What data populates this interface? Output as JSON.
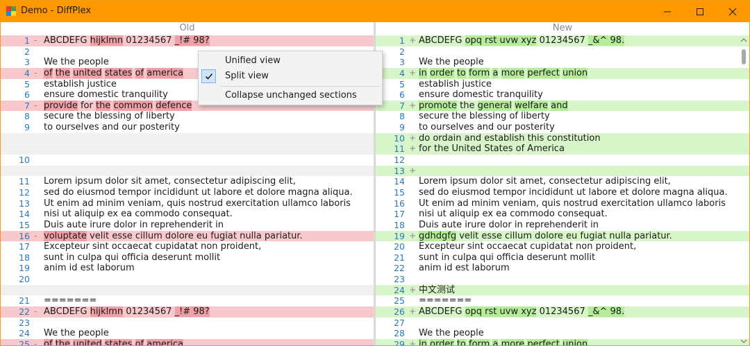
{
  "window": {
    "title": "Demo - DiffPlex"
  },
  "left_pane": {
    "header": "Old",
    "lines": [
      {
        "n": "1",
        "m": "-",
        "t": "del",
        "seg": [
          [
            "ABCDEFG ",
            0
          ],
          [
            "hijklmn",
            1
          ],
          [
            " 01234567 ",
            0
          ],
          [
            "_!# 98?",
            1
          ]
        ]
      },
      {
        "n": "2",
        "m": "",
        "t": "",
        "seg": [
          [
            "",
            0
          ]
        ]
      },
      {
        "n": "3",
        "m": "",
        "t": "",
        "seg": [
          [
            "We the people",
            0
          ]
        ]
      },
      {
        "n": "4",
        "m": "-",
        "t": "del",
        "seg": [
          [
            "of",
            1
          ],
          [
            " ",
            0
          ],
          [
            "the",
            1
          ],
          [
            " ",
            0
          ],
          [
            "united",
            1
          ],
          [
            " ",
            0
          ],
          [
            "states",
            1
          ],
          [
            " ",
            0
          ],
          [
            "of",
            1
          ],
          [
            " ",
            0
          ],
          [
            "america",
            1
          ]
        ]
      },
      {
        "n": "5",
        "m": "",
        "t": "",
        "seg": [
          [
            "establish justice",
            0
          ]
        ]
      },
      {
        "n": "6",
        "m": "",
        "t": "",
        "seg": [
          [
            "ensure domestic tranquility",
            0
          ]
        ]
      },
      {
        "n": "7",
        "m": "-",
        "t": "del",
        "seg": [
          [
            "provide",
            1
          ],
          [
            " for ",
            0
          ],
          [
            "the",
            1
          ],
          [
            " ",
            0
          ],
          [
            "common",
            1
          ],
          [
            " ",
            0
          ],
          [
            "defence",
            1
          ]
        ]
      },
      {
        "n": "8",
        "m": "",
        "t": "",
        "seg": [
          [
            "secure the blessing of liberty",
            0
          ]
        ]
      },
      {
        "n": "9",
        "m": "",
        "t": "",
        "seg": [
          [
            "to ourselves and our posterity",
            0
          ]
        ]
      },
      {
        "n": "",
        "m": "",
        "t": "imag",
        "seg": [
          [
            "",
            0
          ]
        ]
      },
      {
        "n": "",
        "m": "",
        "t": "imag",
        "seg": [
          [
            "",
            0
          ]
        ]
      },
      {
        "n": "10",
        "m": "",
        "t": "",
        "seg": [
          [
            "",
            0
          ]
        ]
      },
      {
        "n": "",
        "m": "",
        "t": "imag",
        "seg": [
          [
            "",
            0
          ]
        ]
      },
      {
        "n": "11",
        "m": "",
        "t": "",
        "seg": [
          [
            "Lorem ipsum dolor sit amet, consectetur adipiscing elit,",
            0
          ]
        ]
      },
      {
        "n": "12",
        "m": "",
        "t": "",
        "seg": [
          [
            "sed do eiusmod tempor incididunt ut labore et dolore magna aliqua.",
            0
          ]
        ]
      },
      {
        "n": "13",
        "m": "",
        "t": "",
        "seg": [
          [
            "Ut enim ad minim veniam, quis nostrud exercitation ullamco laboris",
            0
          ]
        ]
      },
      {
        "n": "14",
        "m": "",
        "t": "",
        "seg": [
          [
            "nisi ut aliquip ex ea commodo consequat.",
            0
          ]
        ]
      },
      {
        "n": "15",
        "m": "",
        "t": "",
        "seg": [
          [
            "Duis aute irure dolor in reprehenderit in",
            0
          ]
        ]
      },
      {
        "n": "16",
        "m": "-",
        "t": "del",
        "seg": [
          [
            "voluptate",
            1
          ],
          [
            " velit esse cillum dolore eu fugiat nulla pariatur.",
            0
          ]
        ]
      },
      {
        "n": "17",
        "m": "",
        "t": "",
        "seg": [
          [
            "Excepteur sint occaecat cupidatat non proident,",
            0
          ]
        ]
      },
      {
        "n": "18",
        "m": "",
        "t": "",
        "seg": [
          [
            "sunt in culpa qui officia deserunt mollit",
            0
          ]
        ]
      },
      {
        "n": "19",
        "m": "",
        "t": "",
        "seg": [
          [
            "anim id est laborum",
            0
          ]
        ]
      },
      {
        "n": "20",
        "m": "",
        "t": "",
        "seg": [
          [
            "",
            0
          ]
        ]
      },
      {
        "n": "",
        "m": "",
        "t": "imag",
        "seg": [
          [
            "",
            0
          ]
        ]
      },
      {
        "n": "21",
        "m": "",
        "t": "",
        "seg": [
          [
            "=======",
            0
          ]
        ]
      },
      {
        "n": "22",
        "m": "-",
        "t": "del",
        "seg": [
          [
            "ABCDEFG ",
            0
          ],
          [
            "hijklmn",
            1
          ],
          [
            " 01234567 ",
            0
          ],
          [
            "_!# 98?",
            1
          ]
        ]
      },
      {
        "n": "23",
        "m": "",
        "t": "",
        "seg": [
          [
            "",
            0
          ]
        ]
      },
      {
        "n": "24",
        "m": "",
        "t": "",
        "seg": [
          [
            "We the people",
            0
          ]
        ]
      },
      {
        "n": "25",
        "m": "-",
        "t": "del",
        "seg": [
          [
            "of",
            1
          ],
          [
            " ",
            0
          ],
          [
            "the",
            1
          ],
          [
            " ",
            0
          ],
          [
            "united",
            1
          ],
          [
            " ",
            0
          ],
          [
            "states",
            1
          ],
          [
            " ",
            0
          ],
          [
            "of",
            1
          ],
          [
            " ",
            0
          ],
          [
            "america",
            1
          ]
        ]
      }
    ]
  },
  "right_pane": {
    "header": "New",
    "lines": [
      {
        "n": "1",
        "m": "+",
        "t": "ins",
        "seg": [
          [
            "ABCDEFG ",
            0
          ],
          [
            "opq rst uvw xyz",
            1
          ],
          [
            " 01234567 ",
            0
          ],
          [
            "_&^ 98.",
            1
          ]
        ]
      },
      {
        "n": "2",
        "m": "",
        "t": "",
        "seg": [
          [
            "",
            0
          ]
        ]
      },
      {
        "n": "3",
        "m": "",
        "t": "",
        "seg": [
          [
            "We the people",
            0
          ]
        ]
      },
      {
        "n": "4",
        "m": "+",
        "t": "ins",
        "seg": [
          [
            "in",
            1
          ],
          [
            " ",
            0
          ],
          [
            "order",
            1
          ],
          [
            " ",
            0
          ],
          [
            "to",
            1
          ],
          [
            " ",
            0
          ],
          [
            "form",
            1
          ],
          [
            " ",
            0
          ],
          [
            "a",
            1
          ],
          [
            " ",
            0
          ],
          [
            "more",
            1
          ],
          [
            " ",
            0
          ],
          [
            "perfect",
            1
          ],
          [
            " ",
            0
          ],
          [
            "union",
            1
          ]
        ]
      },
      {
        "n": "5",
        "m": "",
        "t": "",
        "seg": [
          [
            "establish justice",
            0
          ]
        ]
      },
      {
        "n": "6",
        "m": "",
        "t": "",
        "seg": [
          [
            "ensure domestic tranquility",
            0
          ]
        ]
      },
      {
        "n": "7",
        "m": "+",
        "t": "ins",
        "seg": [
          [
            "promote",
            1
          ],
          [
            " the ",
            0
          ],
          [
            "general",
            1
          ],
          [
            " ",
            0
          ],
          [
            "welfare",
            1
          ],
          [
            " ",
            0
          ],
          [
            "and",
            1
          ]
        ]
      },
      {
        "n": "8",
        "m": "",
        "t": "",
        "seg": [
          [
            "secure the blessing of liberty",
            0
          ]
        ]
      },
      {
        "n": "9",
        "m": "",
        "t": "",
        "seg": [
          [
            "to ourselves and our posterity",
            0
          ]
        ]
      },
      {
        "n": "10",
        "m": "+",
        "t": "ins",
        "seg": [
          [
            "do ordain and establish this constitution",
            0
          ]
        ]
      },
      {
        "n": "11",
        "m": "+",
        "t": "ins",
        "seg": [
          [
            "for the United States of America",
            0
          ]
        ]
      },
      {
        "n": "12",
        "m": "",
        "t": "",
        "seg": [
          [
            "",
            0
          ]
        ]
      },
      {
        "n": "13",
        "m": "+",
        "t": "ins",
        "seg": [
          [
            "",
            0
          ]
        ]
      },
      {
        "n": "14",
        "m": "",
        "t": "",
        "seg": [
          [
            "Lorem ipsum dolor sit amet, consectetur adipiscing elit,",
            0
          ]
        ]
      },
      {
        "n": "15",
        "m": "",
        "t": "",
        "seg": [
          [
            "sed do eiusmod tempor incididunt ut labore et dolore magna aliqua.",
            0
          ]
        ]
      },
      {
        "n": "16",
        "m": "",
        "t": "",
        "seg": [
          [
            "Ut enim ad minim veniam, quis nostrud exercitation ullamco laboris",
            0
          ]
        ]
      },
      {
        "n": "17",
        "m": "",
        "t": "",
        "seg": [
          [
            "nisi ut aliquip ex ea commodo consequat.",
            0
          ]
        ]
      },
      {
        "n": "18",
        "m": "",
        "t": "",
        "seg": [
          [
            "Duis aute irure dolor in reprehenderit in",
            0
          ]
        ]
      },
      {
        "n": "19",
        "m": "+",
        "t": "ins",
        "seg": [
          [
            "gdhdgfg",
            1
          ],
          [
            " velit esse cillum dolore eu fugiat nulla pariatur.",
            0
          ]
        ]
      },
      {
        "n": "20",
        "m": "",
        "t": "",
        "seg": [
          [
            "Excepteur sint occaecat cupidatat non proident,",
            0
          ]
        ]
      },
      {
        "n": "21",
        "m": "",
        "t": "",
        "seg": [
          [
            "sunt in culpa qui officia deserunt mollit",
            0
          ]
        ]
      },
      {
        "n": "22",
        "m": "",
        "t": "",
        "seg": [
          [
            "anim id est laborum",
            0
          ]
        ]
      },
      {
        "n": "23",
        "m": "",
        "t": "",
        "seg": [
          [
            "",
            0
          ]
        ]
      },
      {
        "n": "24",
        "m": "+",
        "t": "ins",
        "seg": [
          [
            "中文测试",
            0
          ]
        ]
      },
      {
        "n": "25",
        "m": "",
        "t": "",
        "seg": [
          [
            "=======",
            0
          ]
        ]
      },
      {
        "n": "26",
        "m": "+",
        "t": "ins",
        "seg": [
          [
            "ABCDEFG ",
            0
          ],
          [
            "opq rst uvw xyz",
            1
          ],
          [
            " 01234567 ",
            0
          ],
          [
            "_&^ 98.",
            1
          ]
        ]
      },
      {
        "n": "27",
        "m": "",
        "t": "",
        "seg": [
          [
            "",
            0
          ]
        ]
      },
      {
        "n": "28",
        "m": "",
        "t": "",
        "seg": [
          [
            "We the people",
            0
          ]
        ]
      },
      {
        "n": "29",
        "m": "+",
        "t": "ins",
        "seg": [
          [
            "in",
            1
          ],
          [
            " ",
            0
          ],
          [
            "order",
            1
          ],
          [
            " ",
            0
          ],
          [
            "to",
            1
          ],
          [
            " ",
            0
          ],
          [
            "form",
            1
          ],
          [
            " ",
            0
          ],
          [
            "a",
            1
          ],
          [
            " ",
            0
          ],
          [
            "more",
            1
          ],
          [
            " ",
            0
          ],
          [
            "perfect",
            1
          ],
          [
            " ",
            0
          ],
          [
            "union",
            1
          ]
        ]
      }
    ]
  },
  "context_menu": {
    "unified_view": "Unified view",
    "split_view": "Split view",
    "split_view_checked": true,
    "collapse_unchanged": "Collapse unchanged sections"
  },
  "colors": {
    "titlebar": "#ff9800",
    "deleted_line": "#f7c9cc",
    "deleted_word": "#efa0a6",
    "inserted_line": "#d7f5c8",
    "inserted_word": "#b5ec99",
    "line_number": "#2b78b8"
  }
}
